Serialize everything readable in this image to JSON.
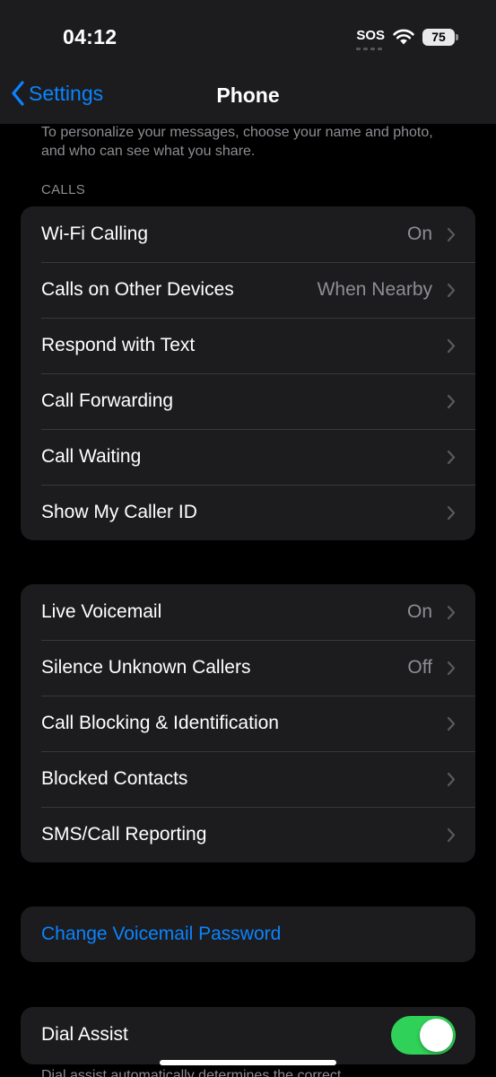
{
  "status_bar": {
    "time": "04:12",
    "sos": "SOS",
    "battery": "75"
  },
  "nav": {
    "back_label": "Settings",
    "title": "Phone"
  },
  "intro_footnote": "To personalize your messages, choose your name and photo, and who can see what you share.",
  "calls_section": {
    "header": "CALLS",
    "rows": [
      {
        "label": "Wi-Fi Calling",
        "value": "On"
      },
      {
        "label": "Calls on Other Devices",
        "value": "When Nearby"
      },
      {
        "label": "Respond with Text",
        "value": ""
      },
      {
        "label": "Call Forwarding",
        "value": ""
      },
      {
        "label": "Call Waiting",
        "value": ""
      },
      {
        "label": "Show My Caller ID",
        "value": ""
      }
    ]
  },
  "voicemail_section": {
    "rows": [
      {
        "label": "Live Voicemail",
        "value": "On"
      },
      {
        "label": "Silence Unknown Callers",
        "value": "Off"
      },
      {
        "label": "Call Blocking & Identification",
        "value": ""
      },
      {
        "label": "Blocked Contacts",
        "value": ""
      },
      {
        "label": "SMS/Call Reporting",
        "value": ""
      }
    ]
  },
  "change_password": {
    "label": "Change Voicemail Password"
  },
  "dial_assist": {
    "label": "Dial Assist",
    "enabled": true
  },
  "dial_assist_footnote": "Dial assist automatically determines the correct",
  "colors": {
    "accent": "#0a84ff",
    "toggle_on": "#30d158",
    "group_bg": "#1c1c1e",
    "secondary_text": "#8d8d93"
  }
}
